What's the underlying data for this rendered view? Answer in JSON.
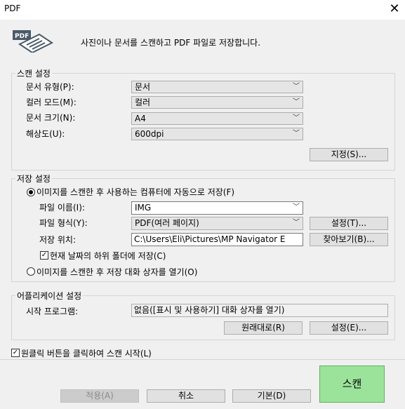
{
  "window": {
    "title": "PDF"
  },
  "header": {
    "description": "사진이나 문서를 스캔하고 PDF 파일로 저장합니다."
  },
  "scan_settings": {
    "group_label": "스캔 설정",
    "doc_type_label": "문서 유형(P):",
    "doc_type_value": "문서",
    "color_mode_label": "컬러 모드(M):",
    "color_mode_value": "컬러",
    "doc_size_label": "문서 크기(N):",
    "doc_size_value": "A4",
    "resolution_label": "해상도(U):",
    "resolution_value": "600dpi",
    "specify_button": "지정(S)..."
  },
  "save_settings": {
    "group_label": "저장 설정",
    "radio_auto_save": "이미지를 스캔한 후 사용하는 컴퓨터에 자동으로 저장(F)",
    "file_name_label": "파일 이름(I):",
    "file_name_value": "IMG",
    "file_type_label": "파일 형식(Y):",
    "file_type_value": "PDF(여러 페이지)",
    "settings_t_button": "설정(T)...",
    "save_location_label": "저장 위치:",
    "save_location_value": "C:\\Users\\Eli\\Pictures\\MP Navigator E",
    "browse_button": "찾아보기(B)...",
    "subfolder_check": "현재 날짜의 하위 폴더에 저장(C)",
    "radio_open_dialog": "이미지를 스캔한 후 저장 대화 상자를 열기(O)"
  },
  "app_settings": {
    "group_label": "어플리케이션 설정",
    "start_program_label": "시작 프로그램:",
    "start_program_value": "없음([표시 및 사용하기] 대화 상자를 열기)",
    "restore_button": "원래대로(R)",
    "settings_e_button": "설정(E)..."
  },
  "footer": {
    "one_click_check": "원클릭 버튼을 클릭하여 스캔 시작(L)",
    "apply_button": "적용(A)",
    "cancel_button": "취소",
    "default_button": "기본(D)",
    "scan_button": "스캔"
  }
}
